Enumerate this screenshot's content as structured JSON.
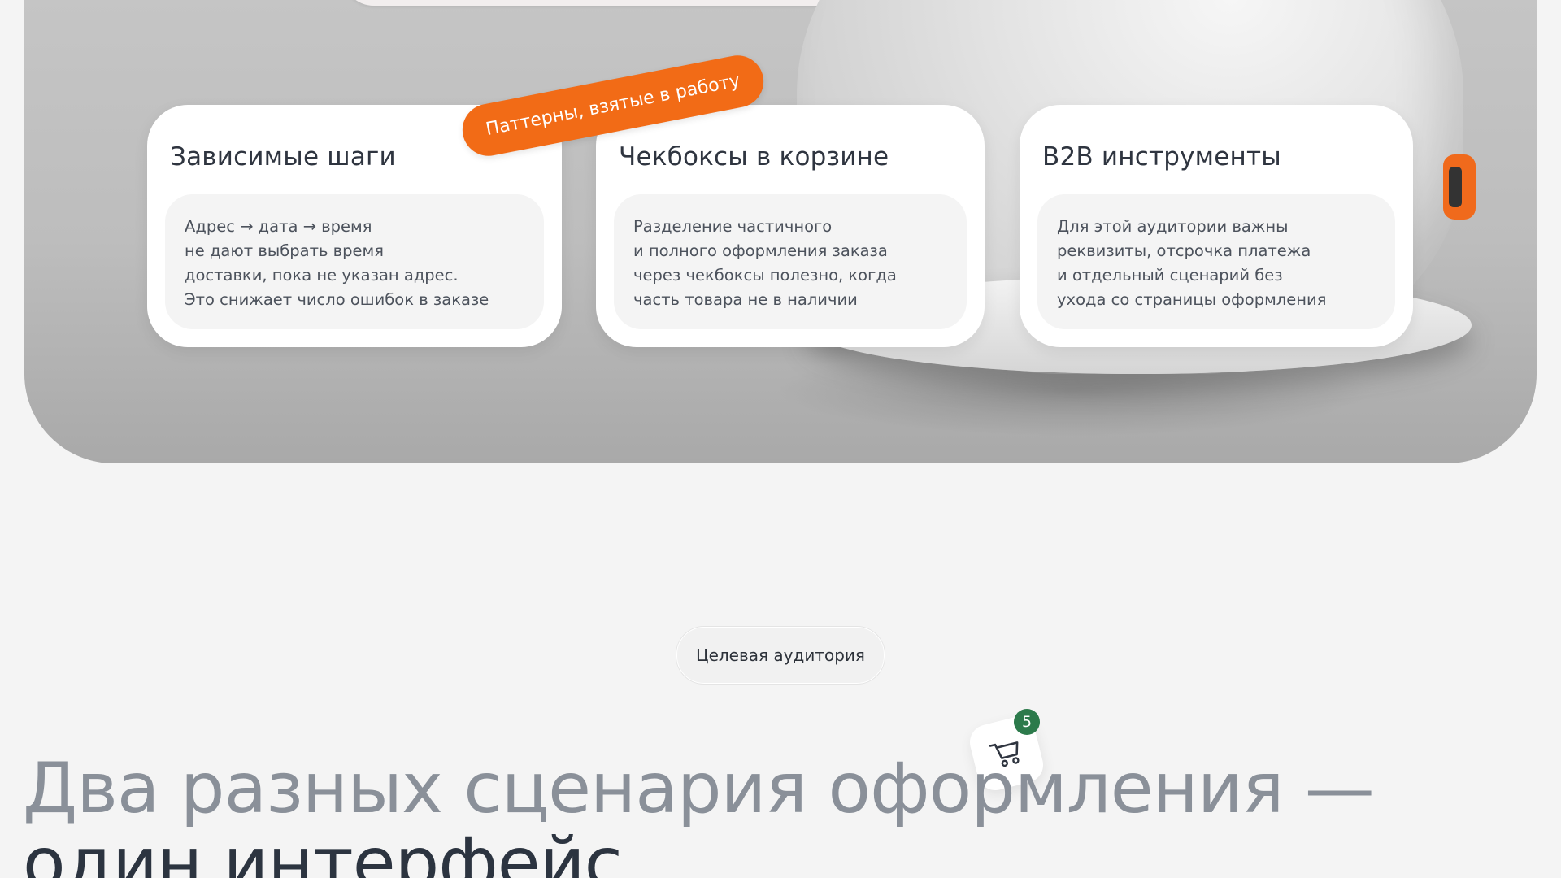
{
  "hero": {
    "tag_label": "Паттерны, взятые в работу",
    "cards": [
      {
        "title": "Зависимые шаги",
        "lines": [
          "Адрес → дата → время",
          "не дают выбрать время",
          "доставки, пока не указан адрес.",
          "Это снижает число ошибок в заказе"
        ]
      },
      {
        "title": "Чекбоксы в корзине",
        "lines": [
          "Разделение частичного",
          "и полного оформления заказа",
          "через чекбоксы полезно, когда",
          "часть товара не в наличии"
        ]
      },
      {
        "title": "B2B инструменты",
        "lines": [
          "Для этой аудитории важны",
          "реквизиты, отсрочка платежа",
          "и отдельный сценарий без",
          "ухода со страницы оформления"
        ]
      }
    ]
  },
  "audience": {
    "pill_label": "Целевая аудитория",
    "cart": {
      "icon": "shopping-cart-icon",
      "count": "5"
    },
    "headline_line1": "Два разных сценария оформления —",
    "headline_line2": "один интерфейс"
  },
  "colors": {
    "accent_orange": "#f26b16",
    "badge_green": "#2c7a4b",
    "text_dark": "#2c3440",
    "text_muted": "#8a9099"
  }
}
